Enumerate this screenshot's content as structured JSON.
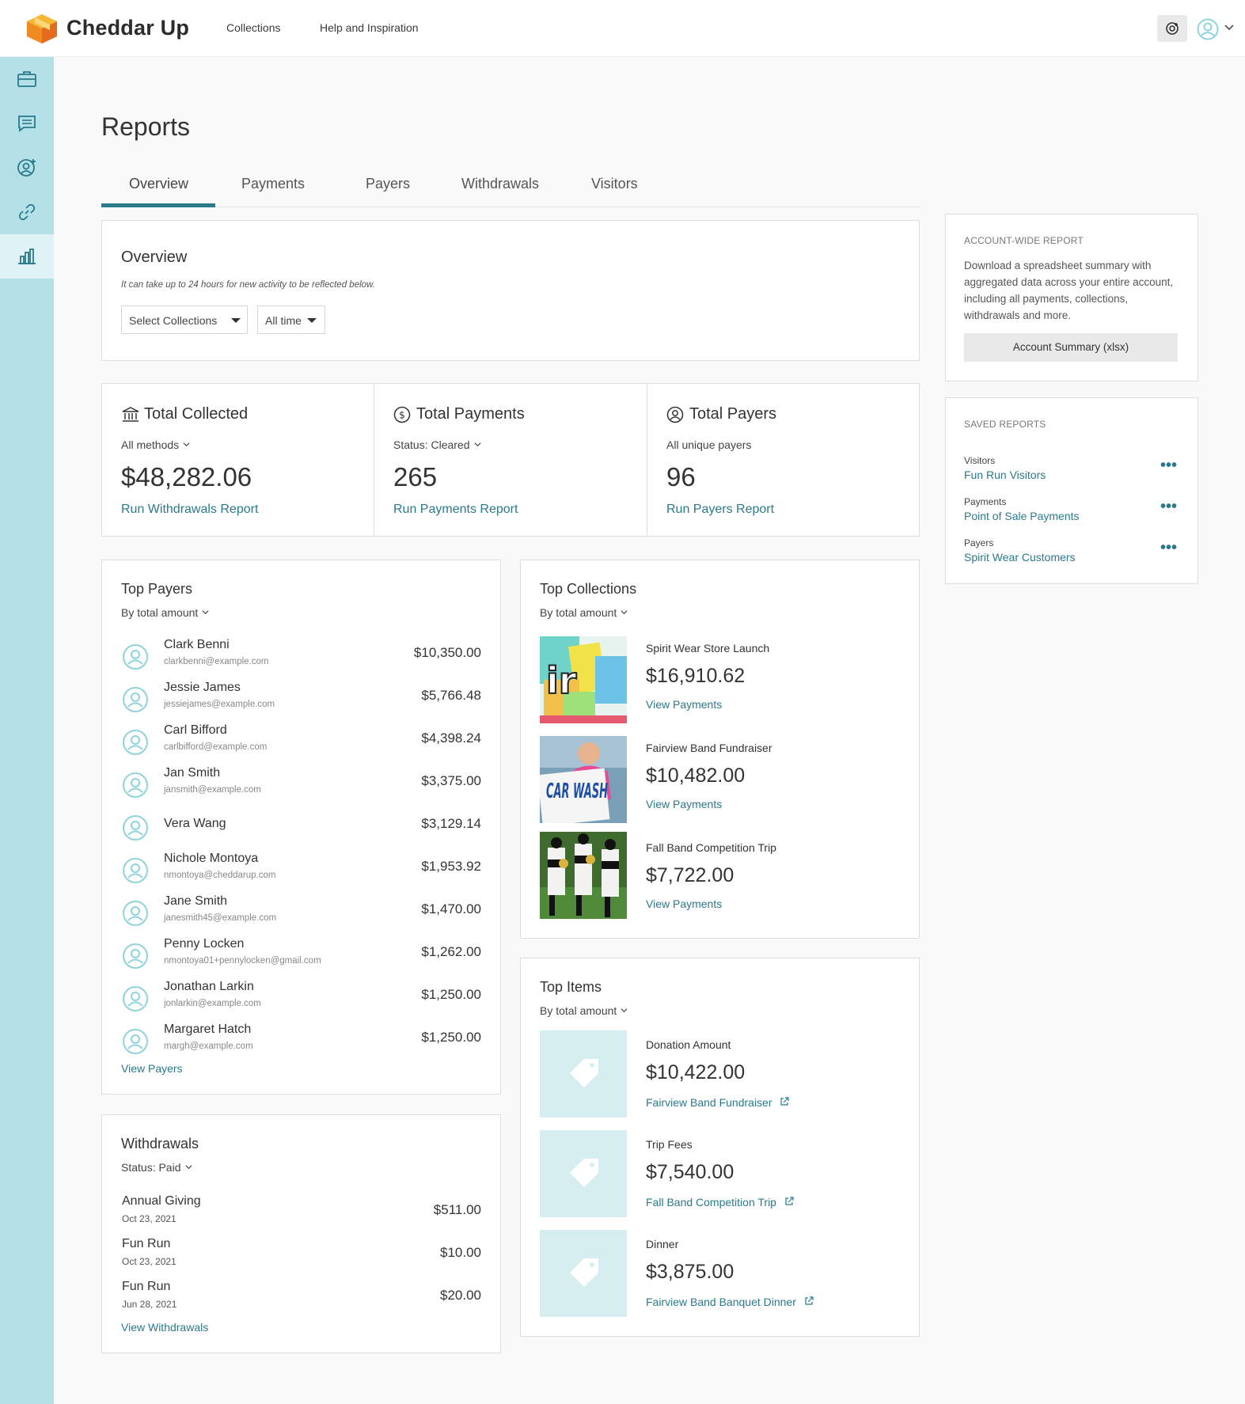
{
  "header": {
    "brand": "Cheddar Up",
    "nav": [
      "Collections",
      "Help and Inspiration"
    ]
  },
  "sidebar": {
    "icons": [
      "briefcase-icon",
      "message-icon",
      "user-add-icon",
      "link-icon",
      "bar-chart-icon"
    ],
    "active": "bar-chart-icon"
  },
  "page": {
    "title": "Reports",
    "tabs": [
      "Overview",
      "Payments",
      "Payers",
      "Withdrawals",
      "Visitors"
    ],
    "active_tab": "Overview"
  },
  "overview": {
    "title": "Overview",
    "note": "It can take up to 24 hours for new activity to be reflected below.",
    "select_collections": "Select Collections",
    "time_filter": "All time"
  },
  "stats": [
    {
      "title": "Total Collected",
      "sub": "All methods",
      "value": "$48,282.06",
      "link": "Run Withdrawals Report",
      "icon": "bank-icon"
    },
    {
      "title": "Total Payments",
      "sub": "Status: Cleared",
      "value": "265",
      "link": "Run Payments Report",
      "icon": "dollar-circle-icon"
    },
    {
      "title": "Total Payers",
      "sub": "All unique payers",
      "value": "96",
      "link": "Run Payers Report",
      "icon": "user-circle-icon"
    }
  ],
  "top_payers": {
    "title": "Top Payers",
    "sort": "By total amount",
    "rows": [
      {
        "name": "Clark Benni",
        "email": "clarkbenni@example.com",
        "amount": "$10,350.00"
      },
      {
        "name": "Jessie James",
        "email": "jessiejames@example.com",
        "amount": "$5,766.48"
      },
      {
        "name": "Carl Bifford",
        "email": "carlbifford@example.com",
        "amount": "$4,398.24"
      },
      {
        "name": "Jan Smith",
        "email": "jansmith@example.com",
        "amount": "$3,375.00"
      },
      {
        "name": "Vera Wang",
        "email": "",
        "amount": "$3,129.14"
      },
      {
        "name": "Nichole Montoya",
        "email": "nmontoya@cheddarup.com",
        "amount": "$1,953.92"
      },
      {
        "name": "Jane Smith",
        "email": "janesmith45@example.com",
        "amount": "$1,470.00"
      },
      {
        "name": "Penny Locken",
        "email": "nmontoya01+pennylocken@gmail.com",
        "amount": "$1,262.00"
      },
      {
        "name": "Jonathan Larkin",
        "email": "jonlarkin@example.com",
        "amount": "$1,250.00"
      },
      {
        "name": "Margaret Hatch",
        "email": "margh@example.com",
        "amount": "$1,250.00"
      }
    ],
    "link": "View Payers"
  },
  "withdrawals": {
    "title": "Withdrawals",
    "status": "Status: Paid",
    "rows": [
      {
        "name": "Annual Giving",
        "date": "Oct 23, 2021",
        "amount": "$511.00"
      },
      {
        "name": "Fun Run",
        "date": "Oct 23, 2021",
        "amount": "$10.00"
      },
      {
        "name": "Fun Run",
        "date": "Jun 28, 2021",
        "amount": "$20.00"
      }
    ],
    "link": "View Withdrawals"
  },
  "top_collections": {
    "title": "Top Collections",
    "sort": "By total amount",
    "rows": [
      {
        "name": "Spirit Wear Store Launch",
        "amount": "$16,910.62",
        "link": "View Payments"
      },
      {
        "name": "Fairview Band Fundraiser",
        "amount": "$10,482.00",
        "link": "View Payments",
        "thumb_text": "CAR WASH"
      },
      {
        "name": "Fall Band Competition Trip",
        "amount": "$7,722.00",
        "link": "View Payments"
      }
    ]
  },
  "top_items": {
    "title": "Top Items",
    "sort": "By total amount",
    "rows": [
      {
        "name": "Donation Amount",
        "amount": "$10,422.00",
        "link": "Fairview Band Fundraiser"
      },
      {
        "name": "Trip Fees",
        "amount": "$7,540.00",
        "link": "Fall Band Competition Trip"
      },
      {
        "name": "Dinner",
        "amount": "$3,875.00",
        "link": "Fairview Band Banquet Dinner"
      }
    ]
  },
  "account_report": {
    "label": "ACCOUNT-WIDE REPORT",
    "description": "Download a spreadsheet summary with aggregated data across your entire account, including all payments, collections, withdrawals and more.",
    "button": "Account Summary (xlsx)"
  },
  "saved_reports": {
    "label": "SAVED REPORTS",
    "rows": [
      {
        "type": "Visitors",
        "name": "Fun Run Visitors"
      },
      {
        "type": "Payments",
        "name": "Point of Sale Payments"
      },
      {
        "type": "Payers",
        "name": "Spirit Wear Customers"
      }
    ]
  },
  "colors": {
    "accent": "#2a7a8c",
    "rail": "#b3e1e7",
    "brand_orange": "#f5a623"
  }
}
